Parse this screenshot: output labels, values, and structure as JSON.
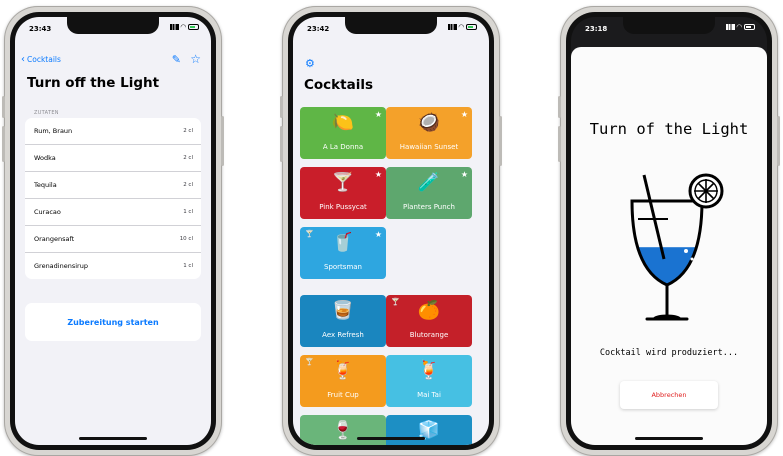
{
  "phone1": {
    "time": "23:43",
    "back_label": "Cocktails",
    "title": "Turn off the Light",
    "section": "ZUTATEN",
    "ingredients": [
      {
        "name": "Rum, Braun",
        "amount": "2 cl"
      },
      {
        "name": "Wodka",
        "amount": "2 cl"
      },
      {
        "name": "Tequila",
        "amount": "2 cl"
      },
      {
        "name": "Curacao",
        "amount": "1 cl"
      },
      {
        "name": "Orangensaft",
        "amount": "10 cl"
      },
      {
        "name": "Grenadinensirup",
        "amount": "1 cl"
      }
    ],
    "start_button": "Zubereitung starten"
  },
  "phone2": {
    "time": "23:42",
    "title": "Cocktails",
    "tiles": [
      {
        "label": "A La Donna",
        "color": "#5fb646",
        "icon": "lime-icon",
        "glyph": "🍋",
        "fav": "★",
        "alc": ""
      },
      {
        "label": "Hawaiian Sunset",
        "color": "#f4a12a",
        "icon": "coconut-icon",
        "glyph": "🥥",
        "fav": "★",
        "alc": ""
      },
      {
        "label": "Pink Pussycat",
        "color": "#c91e2a",
        "icon": "martini-icon",
        "glyph": "🍸",
        "fav": "★",
        "alc": ""
      },
      {
        "label": "Planters Punch",
        "color": "#5ea76e",
        "icon": "tube-glass-icon",
        "glyph": "🧪",
        "fav": "★",
        "alc": ""
      },
      {
        "label": "Sportsman",
        "color": "#2ea6e0",
        "icon": "tall-glass-icon",
        "glyph": "🥤",
        "fav": "★",
        "alc": "🍸"
      },
      {
        "label": "Aex Refresh",
        "color": "#1a86bf",
        "icon": "tumbler-icon",
        "glyph": "🥃",
        "fav": "",
        "alc": ""
      },
      {
        "label": "Blutorange",
        "color": "#c42029",
        "icon": "orange-icon",
        "glyph": "🍊",
        "fav": "",
        "alc": "🍸"
      },
      {
        "label": "Fruit Cup",
        "color": "#f49b1e",
        "icon": "fruit-cup-icon",
        "glyph": "🍹",
        "fav": "",
        "alc": "🍸"
      },
      {
        "label": "Mai Tai",
        "color": "#46c0e3",
        "icon": "cocktail-icon",
        "glyph": "🍹",
        "fav": "",
        "alc": ""
      },
      {
        "label": "",
        "color": "#6ab57a",
        "icon": "wine-glass-icon",
        "glyph": "🍷",
        "fav": "",
        "alc": ""
      },
      {
        "label": "",
        "color": "#1d8fc4",
        "icon": "ice-glass-icon",
        "glyph": "🧊",
        "fav": "",
        "alc": ""
      }
    ]
  },
  "phone3": {
    "time": "23:18",
    "title": "Turn of the Light",
    "status": "Cocktail wird produziert...",
    "cancel_button": "Abbrechen",
    "fill_fraction": 0.45
  }
}
